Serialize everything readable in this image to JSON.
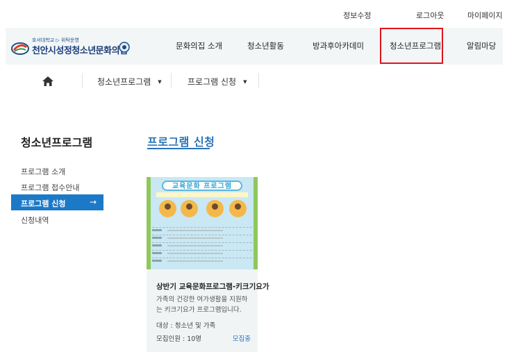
{
  "utility": {
    "edit_profile": "정보수정",
    "logout": "로그아웃",
    "mypage": "마이페이지"
  },
  "logo": {
    "subtitle": "호서대학교 ▷ 위탁운영",
    "title": "천안시성정청소년문화의집"
  },
  "nav": {
    "items": [
      "문화의집 소개",
      "청소년활동",
      "방과후아카데미",
      "청소년프로그램",
      "알림마당"
    ],
    "highlighted_index": 3
  },
  "breadcrumb": {
    "level1": "청소년프로그램",
    "level2": "프로그램 신청"
  },
  "sidebar": {
    "title": "청소년프로그램",
    "items": [
      "프로그램 소개",
      "프로그램 접수안내",
      "프로그램 신청",
      "신청내역"
    ],
    "active_index": 2,
    "active_arrow": "→"
  },
  "page": {
    "title": "프로그램 신청"
  },
  "card": {
    "poster_title": "교육문화 프로그램",
    "title": "상반기 교육문화프로그램-키크기요가",
    "description": "가족의 건강한 여가생활을 지원하는 키크기요가 프로그램입니다.",
    "target": "대상 : 청소년 및 가족",
    "count": "모집인원 : 10명",
    "status": "모집중"
  },
  "colors": {
    "accent": "#2a74b8",
    "active_menu": "#1c79c8",
    "highlight_border": "#e0141b",
    "header_bg": "#f3f6f7"
  }
}
